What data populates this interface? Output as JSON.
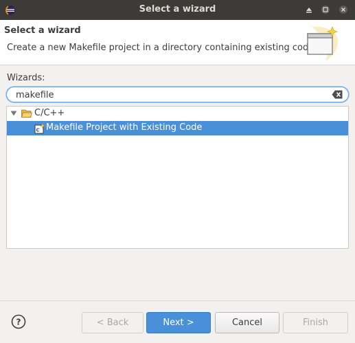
{
  "window": {
    "title": "Select a wizard",
    "app_icon": "eclipse-icon",
    "controls": [
      "minimize-icon",
      "maximize-icon",
      "close-icon"
    ]
  },
  "header": {
    "title": "Select a wizard",
    "description": "Create a new Makefile project in a directory containing existing code",
    "image": "wizard-banner-icon"
  },
  "wizards": {
    "label": "Wizards:",
    "filter_value": "makefile",
    "clear_icon": "clear-text-icon"
  },
  "tree": {
    "category": {
      "label": "C/C++",
      "expanded": true,
      "icon": "folder-open-icon"
    },
    "items": [
      {
        "label": "Makefile Project with Existing Code",
        "selected": true,
        "icon": "c-project-wizard-icon"
      }
    ]
  },
  "footer": {
    "help_icon": "help-icon",
    "back_label": "< Back",
    "next_label": "Next >",
    "cancel_label": "Cancel",
    "finish_label": "Finish"
  },
  "colors": {
    "titlebar": "#3c3b37",
    "selection": "#4a90d9",
    "accent": "#4a90d9",
    "background": "#f2f1f0"
  }
}
